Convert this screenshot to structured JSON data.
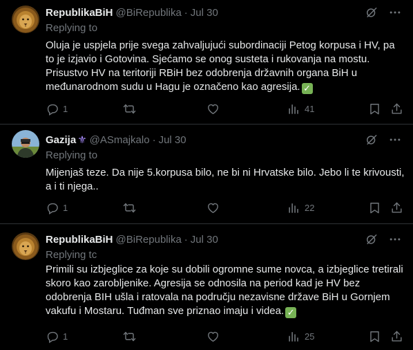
{
  "tweets": [
    {
      "display_name": "RepublikaBiH",
      "handle": "@BiRepublika",
      "separator": "·",
      "date": "Jul 30",
      "replying_to": "Replying to",
      "text_parts": [
        "Oluja je uspjela prije svega zahvaljujući subordinaciji Petog korpusa i HV, pa to je izjavio i Gotovina. Sjećamo se onog susteta i rukovanja na mostu. Prisustvo HV na teritoriji RBiH bez odobrenja državnih organa BiH u međunarodnom sudu u Hagu je označeno kao agresija."
      ],
      "check_emoji": "✓",
      "replies": "1",
      "retweets": "",
      "likes": "",
      "views": "41"
    },
    {
      "display_name": "Gazija",
      "handle": "@ASmajkalo",
      "separator": "·",
      "date": "Jul 30",
      "replying_to": "Replying to",
      "text_parts": [
        "Mijenjaš teze. Da nije 5.korpusa bilo, ne bi ni Hrvatske bilo. Jebo li te krivousti, a i ti njega.."
      ],
      "replies": "1",
      "retweets": "",
      "likes": "",
      "views": "22"
    },
    {
      "display_name": "RepublikaBiH",
      "handle": "@BiRepublika",
      "separator": "·",
      "date": "Jul 30",
      "replying_to": "Replying tc",
      "text_parts": [
        "Primili su izbjeglice za koje su dobili ogromne sume novca, a izbjeglice tretirali skoro kao zarobljenike. Agresija se odnosila na period kad je HV bez odobrenja BIH ušla i ratovala na području nezavisne države BiH u Gornjem vakufu i Mostaru. Tuđman sve priznao imaju i videa."
      ],
      "check_emoji": "✓",
      "replies": "1",
      "retweets": "",
      "likes": "",
      "views": "25"
    }
  ],
  "icons": {
    "reply": "reply-icon",
    "retweet": "retweet-icon",
    "like": "heart-icon",
    "views": "views-chart-icon",
    "bookmark": "bookmark-icon",
    "share": "share-icon",
    "grok": "grok-icon",
    "more": "more-icon"
  },
  "colors": {
    "background": "#000000",
    "text": "#e7e9ea",
    "muted": "#71767b",
    "divider": "#2f3336",
    "check_green": "#77b255",
    "fleur_purple": "#a78bfa"
  }
}
